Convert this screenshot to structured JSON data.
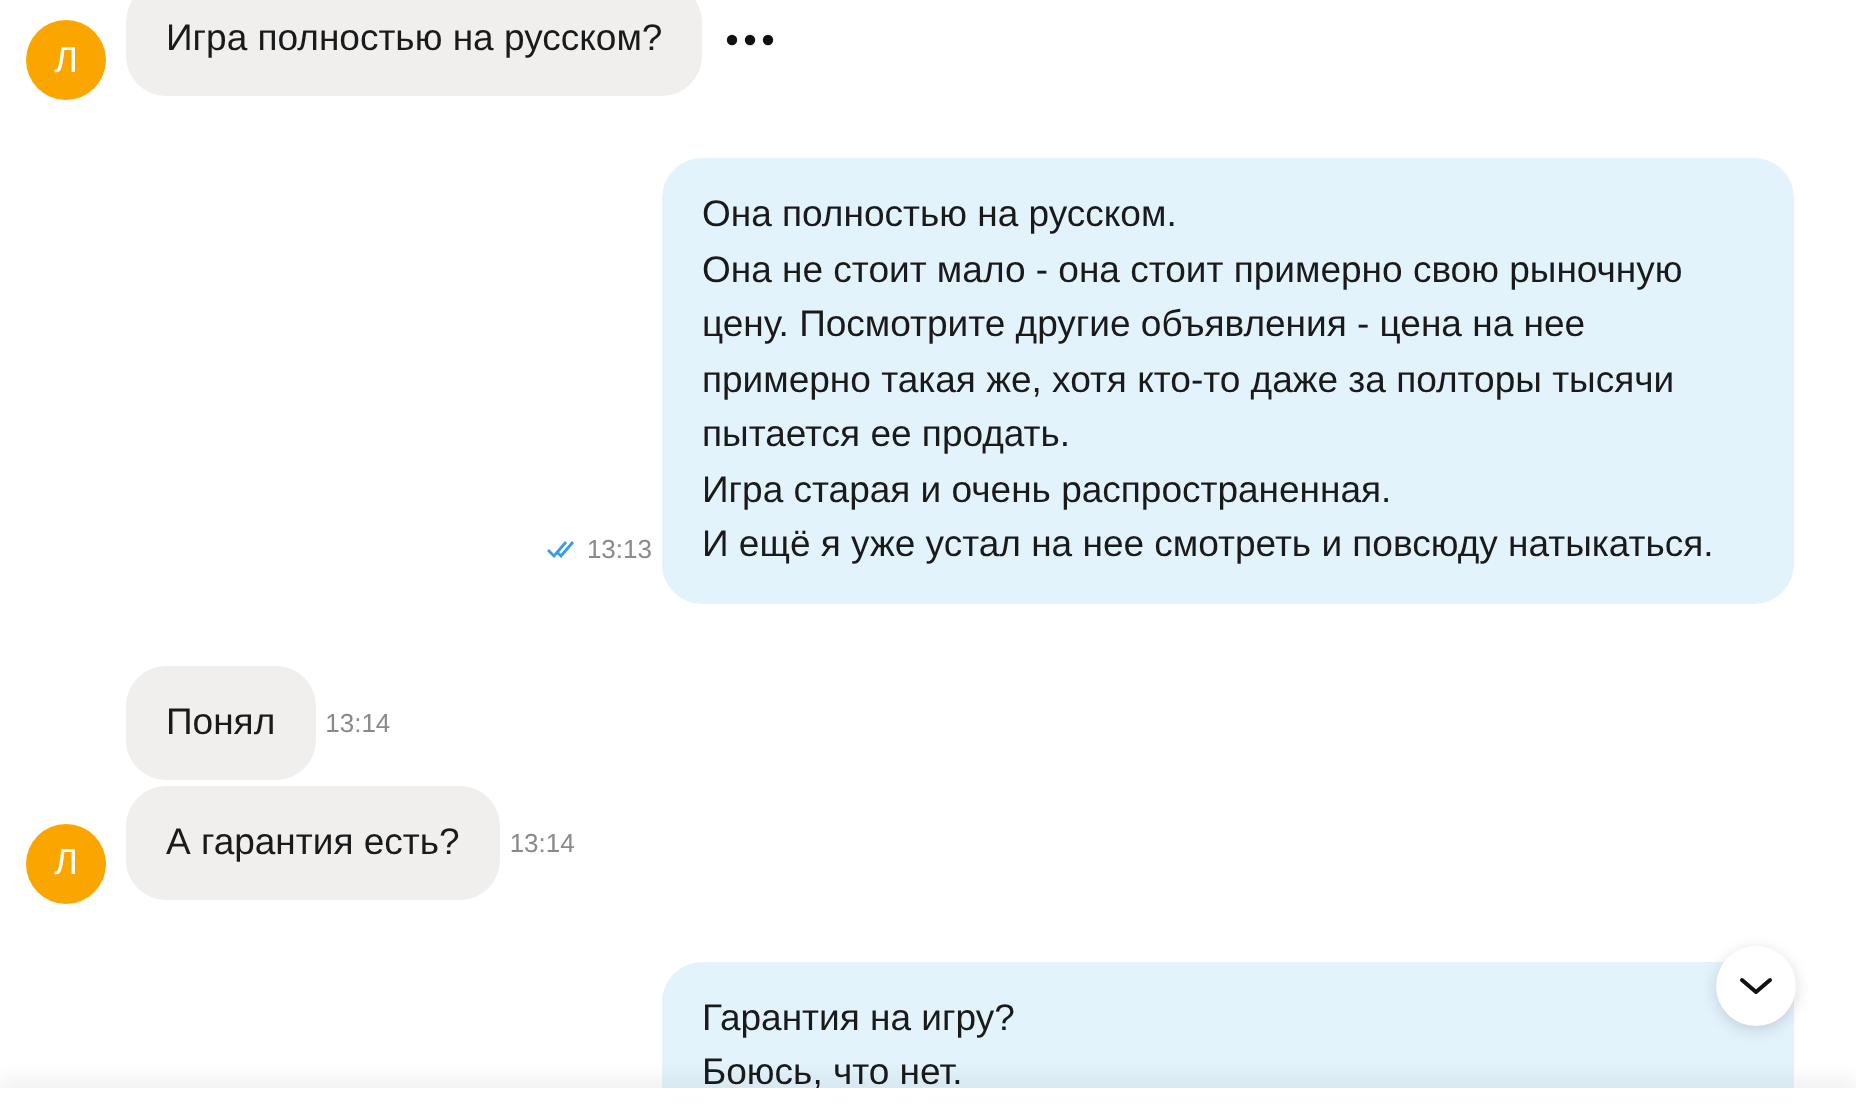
{
  "groups": [
    {
      "messages": [
        {
          "kind": "incoming",
          "text": "Игра полностью на русском?",
          "avatar": "Л",
          "more": true
        }
      ]
    },
    {
      "messages": [
        {
          "kind": "outgoing",
          "paragraphs": [
            "Она полностью на русском.",
            "Она не стоит мало - она стоит примерно свою рыночную цену. Посмотрите другие объявления - цена на нее примерно такая же, хотя кто-то даже за полторы тысячи пытается ее продать.",
            "Игра старая и очень распространенная.",
            "И ещё я уже устал на нее смотреть и повсюду натыкаться."
          ],
          "time": "13:13",
          "read": true
        }
      ]
    },
    {
      "messages": [
        {
          "kind": "incoming",
          "text": "Понял",
          "time": "13:14"
        },
        {
          "kind": "incoming",
          "text": "А гарантия есть?",
          "time": "13:14",
          "avatar": "Л"
        }
      ]
    },
    {
      "messages": [
        {
          "kind": "outgoing",
          "paragraphs": [
            "Гарантия на игру?",
            "Боюсь, что нет."
          ]
        }
      ]
    }
  ],
  "scroll_down": true
}
